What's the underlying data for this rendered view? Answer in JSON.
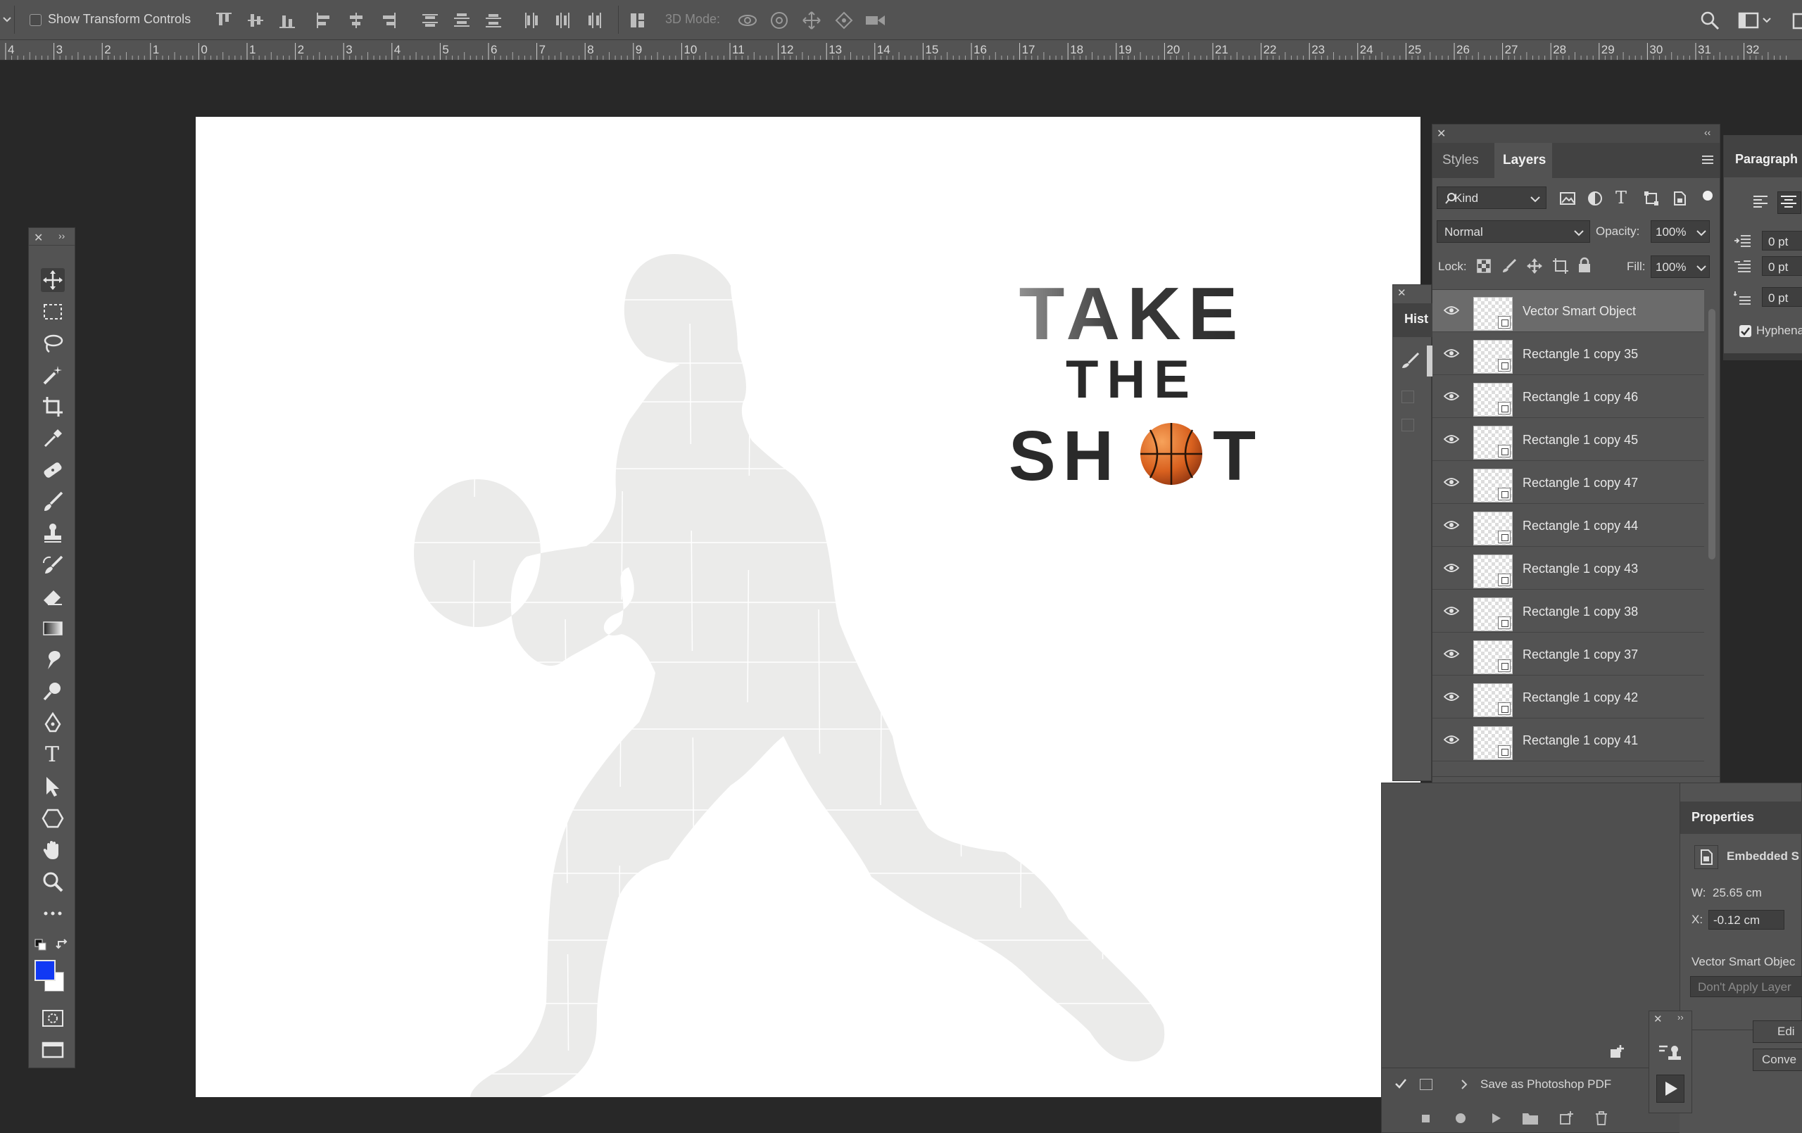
{
  "options_bar": {
    "show_transform_controls_label": "Show Transform Controls",
    "show_transform_checked": false,
    "mode_3d_label": "3D Mode:"
  },
  "ruler": {
    "labels": [
      "4",
      "3",
      "2",
      "1",
      "0",
      "1",
      "2",
      "3",
      "4",
      "5",
      "6",
      "7",
      "8",
      "9",
      "10",
      "11",
      "12",
      "13",
      "14",
      "15",
      "16",
      "17",
      "18",
      "19",
      "20",
      "21",
      "22",
      "23",
      "24",
      "25",
      "26",
      "27",
      "28",
      "29",
      "30",
      "31",
      "32"
    ]
  },
  "tools": {
    "names": [
      "move-tool",
      "marquee-tool",
      "lasso-tool",
      "magic-wand-tool",
      "crop-tool",
      "eyedropper-tool",
      "healing-brush-tool",
      "brush-tool",
      "clone-stamp-tool",
      "history-brush-tool",
      "eraser-tool",
      "gradient-tool",
      "smudge-tool",
      "dodge-tool",
      "pen-tool",
      "type-tool",
      "path-selection-tool",
      "shape-tool",
      "hand-tool",
      "zoom-tool",
      "more-tools"
    ],
    "type_glyph": "T",
    "foreground_color": "#1139f4",
    "background_color": "#ffffff"
  },
  "artwork": {
    "title_line1": "TAKE",
    "title_line2": "THE",
    "title_line3_start": "SH",
    "title_line3_end": "T",
    "silhouette_color": "#ebebea",
    "text_color": "#2a2a2a"
  },
  "layers_panel": {
    "tabs": [
      "Styles",
      "Layers"
    ],
    "active_tab": "Layers",
    "filter_kind": "Kind",
    "blend_mode": "Normal",
    "opacity_label": "Opacity:",
    "opacity_value": "100%",
    "lock_label": "Lock:",
    "fill_label": "Fill:",
    "fill_value": "100%",
    "layers": [
      {
        "name": "Vector Smart Object",
        "selected": true
      },
      {
        "name": "Rectangle 1 copy 35",
        "selected": false
      },
      {
        "name": "Rectangle 1 copy 46",
        "selected": false
      },
      {
        "name": "Rectangle 1 copy 45",
        "selected": false
      },
      {
        "name": "Rectangle 1 copy 47",
        "selected": false
      },
      {
        "name": "Rectangle 1 copy 44",
        "selected": false
      },
      {
        "name": "Rectangle 1 copy 43",
        "selected": false
      },
      {
        "name": "Rectangle 1 copy 38",
        "selected": false
      },
      {
        "name": "Rectangle 1 copy 37",
        "selected": false
      },
      {
        "name": "Rectangle 1 copy 42",
        "selected": false
      },
      {
        "name": "Rectangle 1 copy 41",
        "selected": false
      }
    ]
  },
  "paragraph_panel": {
    "tab": "Paragraph",
    "indent_values": [
      "0 pt",
      "0 pt",
      "0 pt"
    ],
    "hyphenate_label": "Hyphena",
    "hyphenate_checked": true
  },
  "history_panel": {
    "tab": "Hist"
  },
  "properties_panel": {
    "tab": "Properties",
    "type_label": "Embedded S",
    "w_label": "W:",
    "w_value": "25.65 cm",
    "x_label": "X:",
    "x_value": "-0.12 cm",
    "object_label": "Vector Smart Objec",
    "layer_comp_placeholder": "Don't Apply Layer",
    "edit_button": "Edi",
    "convert_button": "Conve"
  },
  "actions_panel": {
    "item_label": "Save as Photoshop PDF",
    "item_checked": true
  }
}
